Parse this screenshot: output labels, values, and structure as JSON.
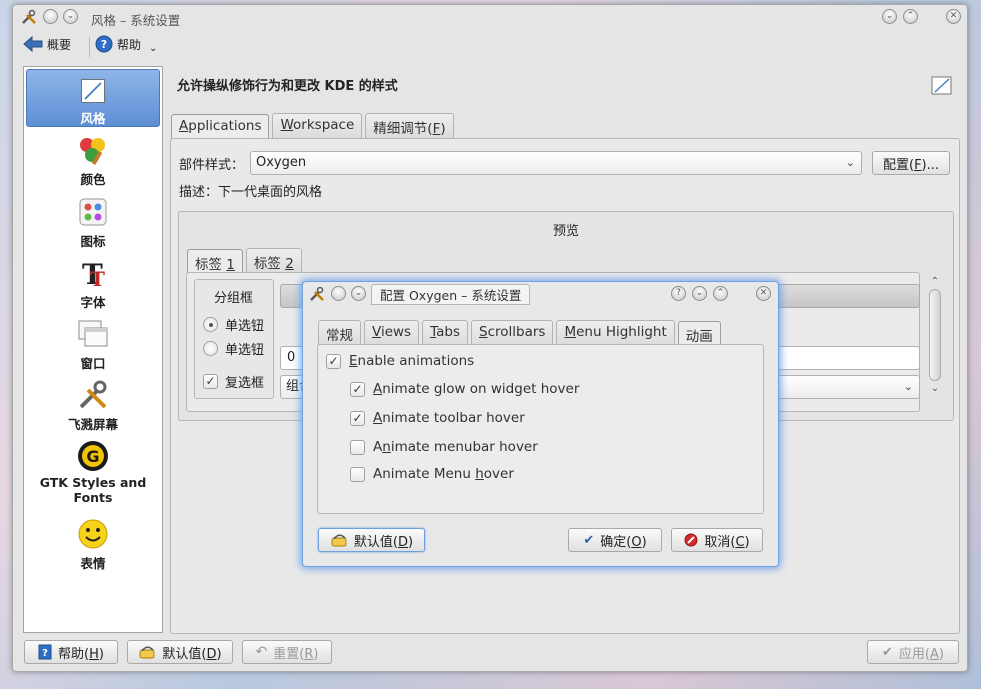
{
  "window": {
    "title": "风格 – 系统设置"
  },
  "toolbar": {
    "overview": "概要",
    "help": "帮助"
  },
  "sidebar": {
    "items": [
      {
        "label": "风格",
        "icon": "style-icon",
        "active": true
      },
      {
        "label": "颜色",
        "icon": "colors-icon"
      },
      {
        "label": "图标",
        "icon": "icons-icon"
      },
      {
        "label": "字体",
        "icon": "fonts-icon"
      },
      {
        "label": "窗口",
        "icon": "windows-icon"
      },
      {
        "label": "飞溅屏幕",
        "icon": "splash-icon"
      },
      {
        "label": "GTK Styles and Fonts",
        "icon": "gtk-icon"
      },
      {
        "label": "表情",
        "icon": "emoticons-icon"
      }
    ]
  },
  "content": {
    "title": "允许操纵修饰行为和更改 KDE 的样式",
    "tabs": [
      {
        "pre": "",
        "u": "A",
        "post": "pplications"
      },
      {
        "pre": "",
        "u": "W",
        "post": "orkspace"
      },
      {
        "pre": "精细调节(",
        "u": "F",
        "post": ")"
      }
    ],
    "widget_style_label": "部件样式：",
    "widget_style_value": "Oxygen",
    "configure_button": {
      "pre": "配置(",
      "u": "F",
      "post": ")..."
    },
    "description": "描述：下一代桌面的风格"
  },
  "preview": {
    "title": "预览",
    "tabs": [
      {
        "pre": "标签 ",
        "u": "1"
      },
      {
        "pre": "标签 ",
        "u": "2"
      }
    ],
    "groupbox": "分组框",
    "radio1": "单选钮",
    "radio2": "单选钮",
    "checkbox": "复选框",
    "spin_value": "0",
    "combo_partial": "组合"
  },
  "dialog": {
    "title": "配置 Oxygen – 系统设置",
    "tabs": [
      {
        "pre": "常规",
        "u": "",
        "post": ""
      },
      {
        "pre": "",
        "u": "V",
        "post": "iews"
      },
      {
        "pre": "",
        "u": "T",
        "post": "abs"
      },
      {
        "pre": "",
        "u": "S",
        "post": "crollbars"
      },
      {
        "pre": "",
        "u": "M",
        "post": "enu Highlight"
      },
      {
        "pre": "动画",
        "u": "",
        "post": ""
      }
    ],
    "options": [
      {
        "pre": "",
        "u": "E",
        "post": "nable animations",
        "checked": true
      },
      {
        "pre": "",
        "u": "A",
        "post": "nimate glow on widget hover",
        "checked": true
      },
      {
        "pre": "",
        "u": "A",
        "post": "nimate toolbar hover",
        "checked": true
      },
      {
        "pre": "A",
        "u": "n",
        "post": "imate menubar hover",
        "checked": false
      },
      {
        "pre": "Animate Menu ",
        "u": "h",
        "post": "over",
        "checked": false
      }
    ],
    "defaults": {
      "pre": "默认值(",
      "u": "D",
      "post": ")"
    },
    "ok": {
      "pre": "确定(",
      "u": "O",
      "post": ")"
    },
    "cancel": {
      "pre": "取消(",
      "u": "C",
      "post": ")"
    }
  },
  "bottom": {
    "help": {
      "pre": "帮助(",
      "u": "H",
      "post": ")"
    },
    "defaults": {
      "pre": "默认值(",
      "u": "D",
      "post": ")"
    },
    "reset": {
      "pre": "重置(",
      "u": "R",
      "post": ")"
    },
    "apply": {
      "pre": "应用(",
      "u": "A",
      "post": ")"
    }
  },
  "colors": {
    "accent": "#5e8fd4",
    "dialog_glow": "#5c96e6"
  }
}
